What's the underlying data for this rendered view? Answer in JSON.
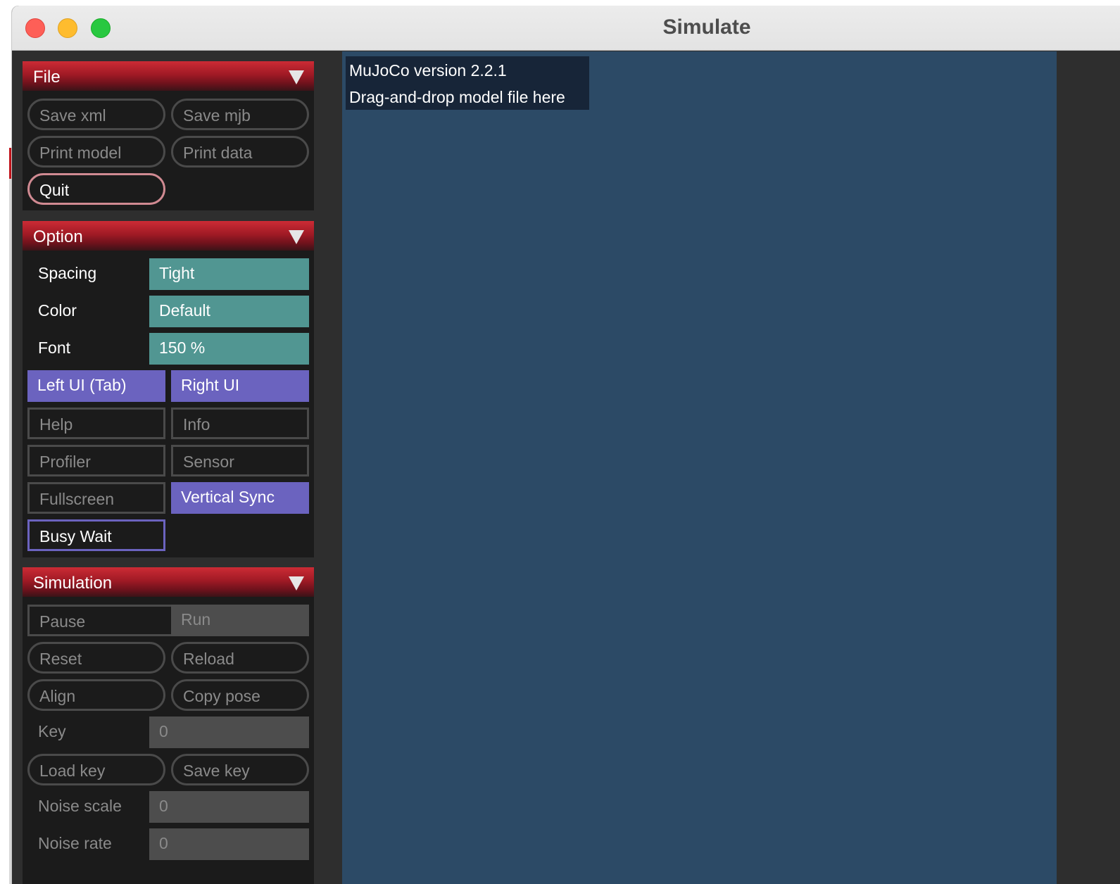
{
  "window": {
    "title": "Simulate"
  },
  "file": {
    "header": "File",
    "save_xml": "Save xml",
    "save_mjb": "Save mjb",
    "print_model": "Print model",
    "print_data": "Print data",
    "quit": "Quit"
  },
  "option": {
    "header": "Option",
    "spacing_label": "Spacing",
    "spacing_value": "Tight",
    "color_label": "Color",
    "color_value": "Default",
    "font_label": "Font",
    "font_value": "150 %",
    "left_ui": "Left UI (Tab)",
    "right_ui": "Right UI",
    "help": "Help",
    "info": "Info",
    "profiler": "Profiler",
    "sensor": "Sensor",
    "fullscreen": "Fullscreen",
    "vertical_sync": "Vertical Sync",
    "busy_wait": "Busy Wait"
  },
  "simulation": {
    "header": "Simulation",
    "pause": "Pause",
    "run": "Run",
    "reset": "Reset",
    "reload": "Reload",
    "align": "Align",
    "copy_pose": "Copy pose",
    "key_label": "Key",
    "key_value": "0",
    "load_key": "Load key",
    "save_key": "Save key",
    "noise_scale_label": "Noise scale",
    "noise_scale_value": "0",
    "noise_rate_label": "Noise rate",
    "noise_rate_value": "0"
  },
  "viewport": {
    "version_text": "MuJoCo version 2.2.1",
    "drop_hint": "Drag-and-drop model file here"
  },
  "colors": {
    "header_red": "#a01a25",
    "teal": "#519692",
    "purple": "#6b63bf",
    "viewport_bg": "#2c4a66"
  }
}
